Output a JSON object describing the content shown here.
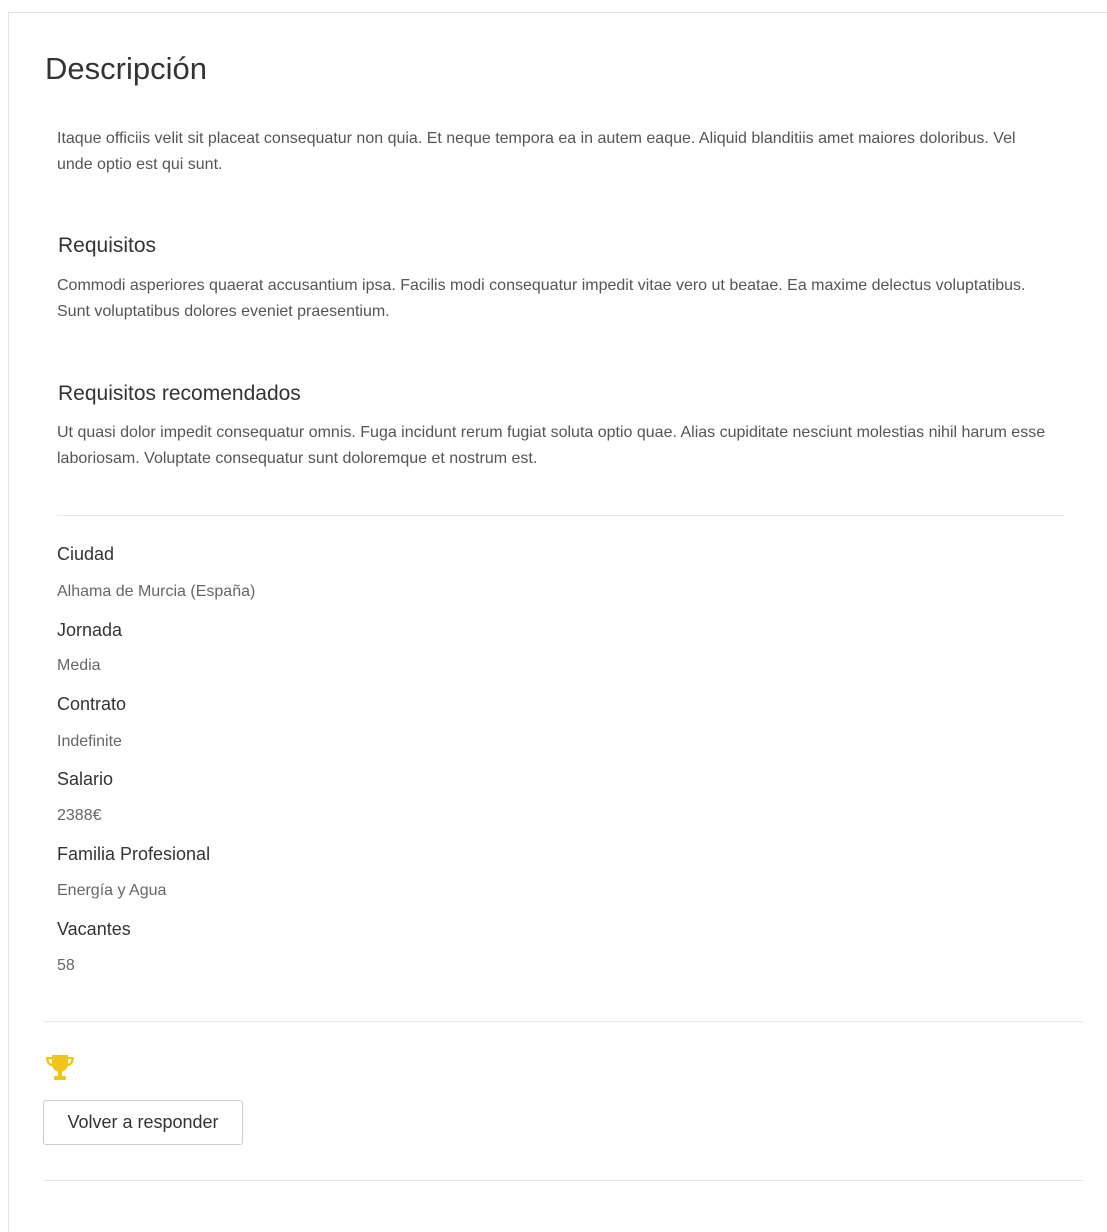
{
  "description": {
    "title": "Descripción",
    "text": "Itaque officiis velit sit placeat consequatur non quia. Et neque tempora ea in autem eaque. Aliquid blanditiis amet maiores doloribus. Vel unde optio est qui sunt."
  },
  "requirements": {
    "title": "Requisitos",
    "text": "Commodi asperiores quaerat accusantium ipsa. Facilis modi consequatur impedit vitae vero ut beatae. Ea maxime delectus voluptatibus. Sunt voluptatibus dolores eveniet praesentium."
  },
  "recommended": {
    "title": "Requisitos recomendados",
    "text": "Ut quasi dolor impedit consequatur omnis. Fuga incidunt rerum fugiat soluta optio quae. Alias cupiditate nesciunt molestias nihil harum esse laboriosam. Voluptate consequatur sunt doloremque et nostrum est."
  },
  "details": [
    {
      "label": "Ciudad",
      "value": "Alhama de Murcia (España)"
    },
    {
      "label": "Jornada",
      "value": "Media"
    },
    {
      "label": "Contrato",
      "value": "Indefinite"
    },
    {
      "label": "Salario",
      "value": "2388€"
    },
    {
      "label": "Familia Profesional",
      "value": "Energía y Agua"
    },
    {
      "label": "Vacantes",
      "value": "58"
    }
  ],
  "actions": {
    "trophy_icon": "trophy-icon",
    "trophy_color": "#f0c419",
    "reanswer_label": "Volver a responder"
  }
}
